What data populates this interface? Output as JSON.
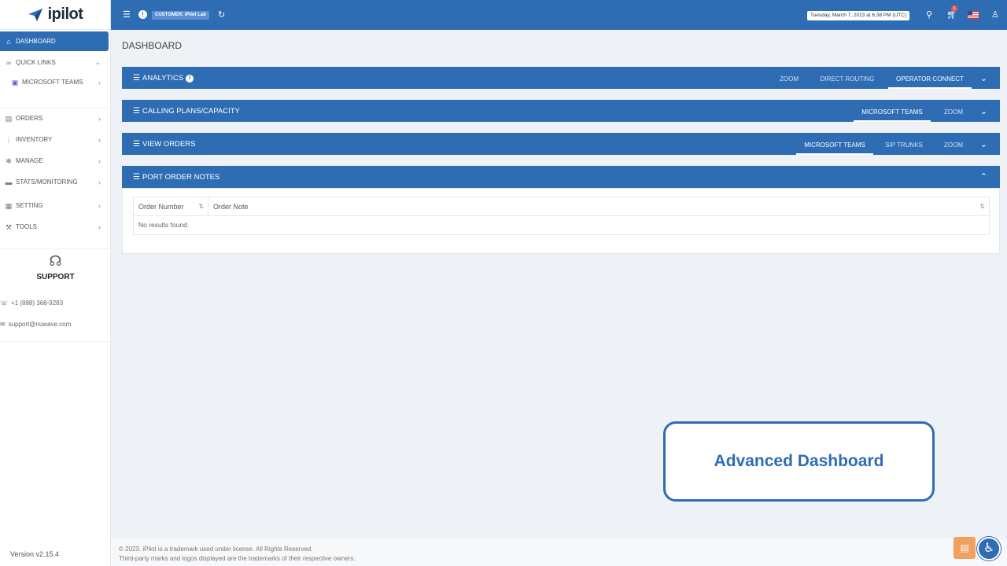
{
  "app": {
    "logo_text": "ipilot",
    "version": "Version v2.15.4"
  },
  "sidebar": {
    "items": [
      {
        "label": "DASHBOARD",
        "icon": "home-icon"
      },
      {
        "label": "QUICK LINKS",
        "icon": "link-icon"
      },
      {
        "label": "MICROSOFT TEAMS",
        "icon": "teams-icon"
      },
      {
        "label": "ORDERS",
        "icon": "orders-icon"
      },
      {
        "label": "INVENTORY",
        "icon": "inventory-icon"
      },
      {
        "label": "MANAGE",
        "icon": "gear-icon"
      },
      {
        "label": "STATS/MONITORING",
        "icon": "monitor-icon"
      },
      {
        "label": "SETTING",
        "icon": "settings-icon"
      },
      {
        "label": "TOOLS",
        "icon": "tools-icon"
      }
    ],
    "support": {
      "title": "SUPPORT",
      "phone": "+1 (888) 368-9283",
      "email": "support@nuwave.com"
    }
  },
  "topbar": {
    "customer": "CUSTOMER: iPilot Lab",
    "datetime": "Tuesday, March 7, 2023 at 6:38 PM (UTC)",
    "cart_count": "1"
  },
  "main": {
    "page_title": "DASHBOARD",
    "panels": [
      {
        "title": "ANALYTICS",
        "tabs": [
          "ZOOM",
          "DIRECT ROUTING",
          "OPERATOR CONNECT"
        ],
        "active_tab": "OPERATOR CONNECT"
      },
      {
        "title": "CALLING PLANS/CAPACITY",
        "tabs": [
          "MICROSOFT TEAMS",
          "ZOOM"
        ],
        "active_tab": "MICROSOFT TEAMS"
      },
      {
        "title": "VIEW ORDERS",
        "tabs": [
          "MICROSOFT TEAMS",
          "SIP TRUNKS",
          "ZOOM"
        ],
        "active_tab": "MICROSOFT TEAMS"
      },
      {
        "title": "PORT ORDER NOTES",
        "tabs": []
      }
    ],
    "port_table": {
      "columns": [
        "Order Number",
        "Order Note"
      ],
      "empty_text": "No results found."
    }
  },
  "callout": {
    "text": "Advanced Dashboard"
  },
  "footer": {
    "line1": "© 2023. iPilot is a trademark used under license. All Rights Reserved.",
    "line2": "Third-party marks and logos displayed are the trademarks of their respective owners."
  },
  "colors": {
    "primary": "#2e6db4",
    "background": "#eef1f5",
    "accent_orange": "#f0a060"
  }
}
